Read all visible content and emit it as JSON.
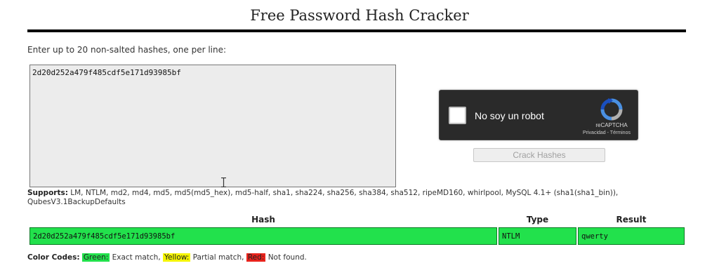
{
  "page": {
    "title": "Free Password Hash Cracker"
  },
  "form": {
    "instruction": "Enter up to 20 non-salted hashes, one per line:",
    "hash_input_value": "2d20d252a479f485cdf5e171d93985bf",
    "crack_button_label": "Crack Hashes"
  },
  "recaptcha": {
    "label": "No soy un robot",
    "brand": "reCAPTCHA",
    "privacy": "Privacidad",
    "separator": " - ",
    "terms": "Términos"
  },
  "supports": {
    "lead": "Supports:",
    "text": " LM, NTLM, md2, md4, md5, md5(md5_hex), md5-half, sha1, sha224, sha256, sha384, sha512, ripeMD160, whirlpool, MySQL 4.1+ (sha1(sha1_bin)), QubesV3.1BackupDefaults"
  },
  "results": {
    "headers": {
      "hash": "Hash",
      "type": "Type",
      "result": "Result"
    },
    "rows": [
      {
        "hash": "2d20d252a479f485cdf5e171d93985bf",
        "type": "NTLM",
        "result": "qwerty",
        "status": "green"
      }
    ]
  },
  "color_codes": {
    "lead": "Color Codes:",
    "green_label": "Green:",
    "green_desc": " Exact match, ",
    "yellow_label": "Yellow:",
    "yellow_desc": " Partial match, ",
    "red_label": "Red:",
    "red_desc": " Not found."
  },
  "colors": {
    "green": "#22e14c",
    "yellow": "#f5f500",
    "red": "#e8231c",
    "captcha_bg": "#2a2a2a"
  }
}
